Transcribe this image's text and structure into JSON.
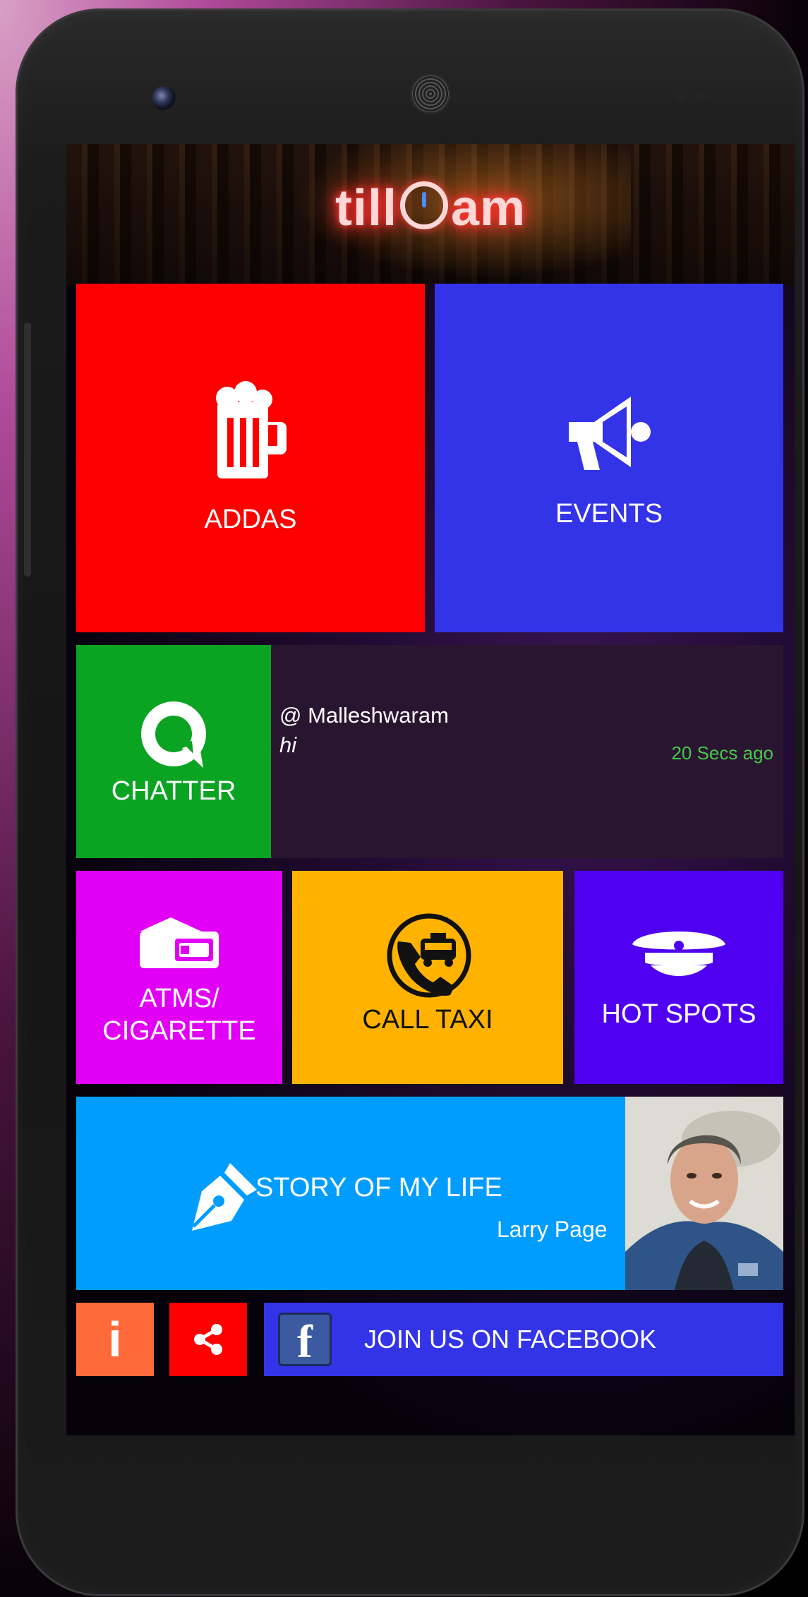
{
  "app": {
    "logo_text_left": "till",
    "logo_text_right": "am"
  },
  "tiles": {
    "addas": {
      "label": "ADDAS",
      "icon": "beer-mug-icon",
      "color": "#ff0000"
    },
    "events": {
      "label": "EVENTS",
      "icon": "megaphone-icon",
      "color": "#3333e8"
    },
    "chatter": {
      "label": "CHATTER",
      "icon": "chat-bubble-icon",
      "color": "#0ba322"
    },
    "atms": {
      "label_line1": "ATMS/",
      "label_line2": "CIGARETTE",
      "icon": "wallet-card-icon",
      "color": "#e100f5"
    },
    "call_taxi": {
      "label": "CALL TAXI",
      "icon": "taxi-phone-icon",
      "color": "#ffb300"
    },
    "hot_spots": {
      "label": "HOT SPOTS",
      "icon": "police-cap-icon",
      "color": "#5000f0"
    },
    "story": {
      "label": "STORY OF MY LIFE",
      "author": "Larry Page",
      "icon": "pen-nib-icon",
      "color": "#009dff"
    }
  },
  "chat_feed": {
    "location": "@ Malleshwaram",
    "message": "hi",
    "time": "20 Secs ago"
  },
  "footer": {
    "info_label": "i",
    "info_color": "#ff6a3a",
    "share_color": "#ff0000",
    "facebook_label": "JOIN US ON FACEBOOK",
    "facebook_icon_letter": "f",
    "facebook_color": "#3333e8"
  }
}
